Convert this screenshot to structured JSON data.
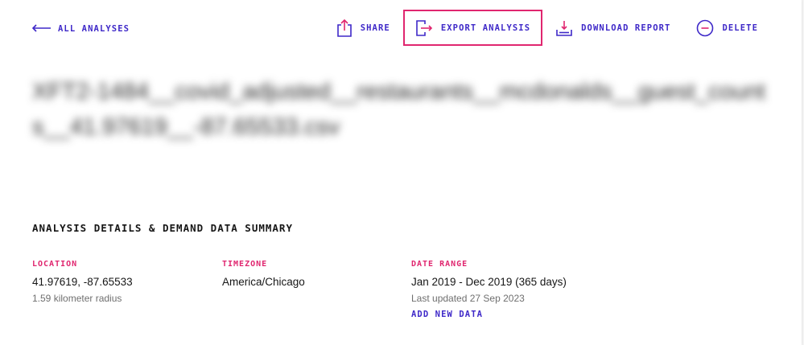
{
  "nav": {
    "back_label": "ALL ANALYSES"
  },
  "toolbar": {
    "share_label": "SHARE",
    "export_label": "EXPORT ANALYSIS",
    "download_label": "DOWNLOAD REPORT",
    "delete_label": "DELETE"
  },
  "file": {
    "title": "XFT2-1484__covid_adjusted__restaurants__mcdonalds__guest_counts__41.97619__-87.65533.csv"
  },
  "details": {
    "heading": "ANALYSIS DETAILS & DEMAND DATA SUMMARY",
    "location": {
      "label": "LOCATION",
      "value": "41.97619, -87.65533",
      "sub": "1.59 kilometer radius"
    },
    "timezone": {
      "label": "TIMEZONE",
      "value": "America/Chicago"
    },
    "date_range": {
      "label": "DATE RANGE",
      "value": "Jan 2019 - Dec 2019 (365 days)",
      "sub": "Last updated 27 Sep 2023",
      "action": "ADD NEW DATA"
    }
  },
  "colors": {
    "accent": "#3e28c8",
    "highlight": "#e0266f",
    "muted": "#6f6f6f"
  },
  "icons": {
    "back": "arrow-left-icon",
    "share": "share-icon",
    "export": "export-icon",
    "download": "download-icon",
    "delete": "minus-circle-icon"
  }
}
